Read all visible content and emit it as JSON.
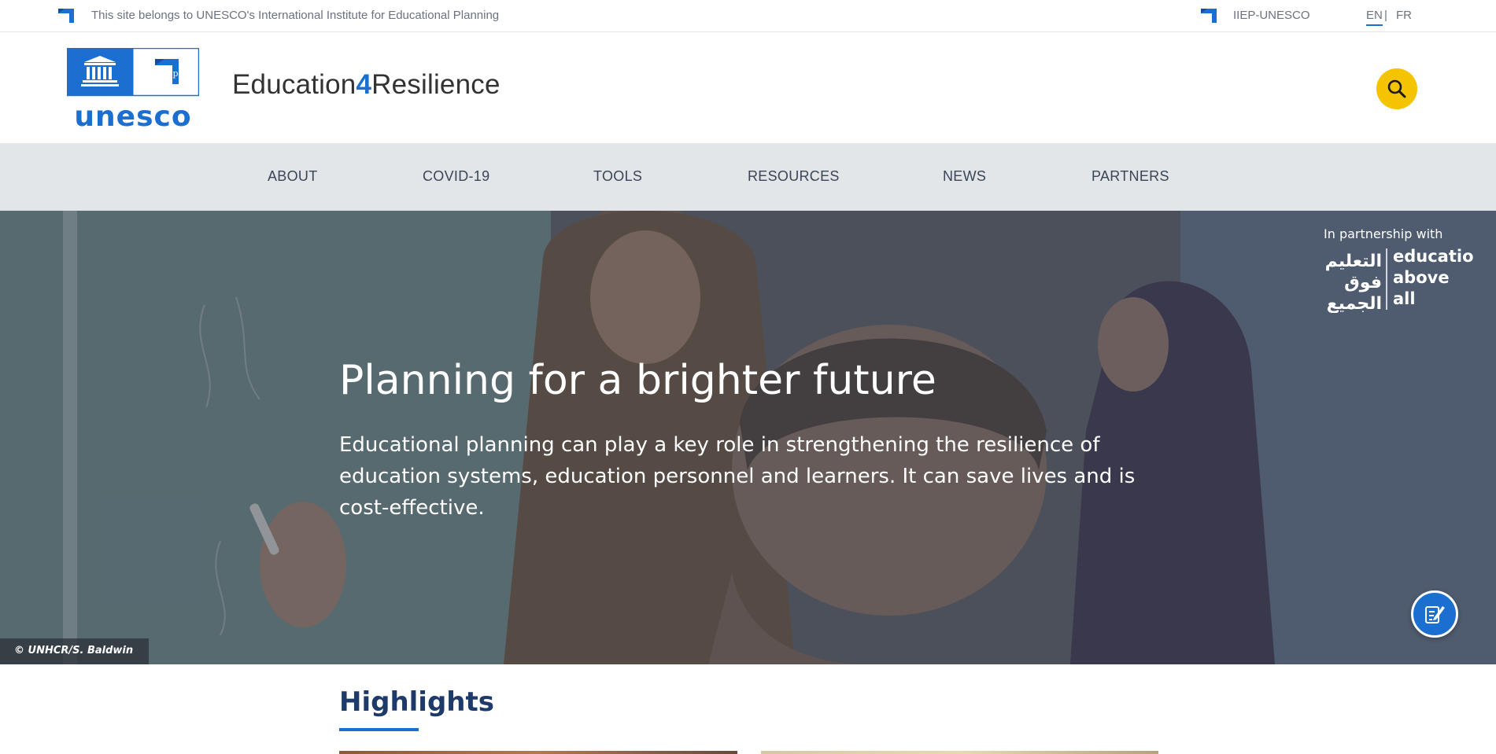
{
  "topbar": {
    "ownership_text": "This site belongs to UNESCO's International Institute for Educational Planning",
    "iiep_link": "IIEP-UNESCO",
    "languages": {
      "en": "EN",
      "separator": "|",
      "fr": "FR"
    }
  },
  "header": {
    "logo_text": "unesco",
    "logo_iiep": "iiep",
    "site_title": {
      "part1": "Education",
      "part2": "4",
      "part3": "Resilience"
    }
  },
  "nav": {
    "items": [
      {
        "label": "ABOUT"
      },
      {
        "label": "COVID-19"
      },
      {
        "label": "TOOLS"
      },
      {
        "label": "RESOURCES"
      },
      {
        "label": "NEWS"
      },
      {
        "label": "PARTNERS"
      }
    ]
  },
  "hero": {
    "title": "Planning for a brighter future",
    "text": "Educational planning can play a key role in strengthening the resilience of education systems, education personnel and learners. It can save lives and is cost-effective.",
    "partnership_label": "In partnership with",
    "partner_logo": {
      "arabic_1": "التعليم",
      "arabic_2": "فوق",
      "arabic_3": "الجميع",
      "english_1": "education",
      "english_2": "above",
      "english_3": "all"
    },
    "photo_credit": "© UNHCR/S. Baldwin"
  },
  "highlights": {
    "title": "Highlights"
  },
  "colors": {
    "accent_blue": "#1b6fd1",
    "search_yellow": "#f5c400",
    "nav_bg": "#e3e6e9",
    "heading_navy": "#1e3a6b"
  },
  "icons": {
    "iiep_mark": "iiep-flag-icon",
    "search": "search-icon",
    "feedback": "feedback-pen-icon"
  }
}
